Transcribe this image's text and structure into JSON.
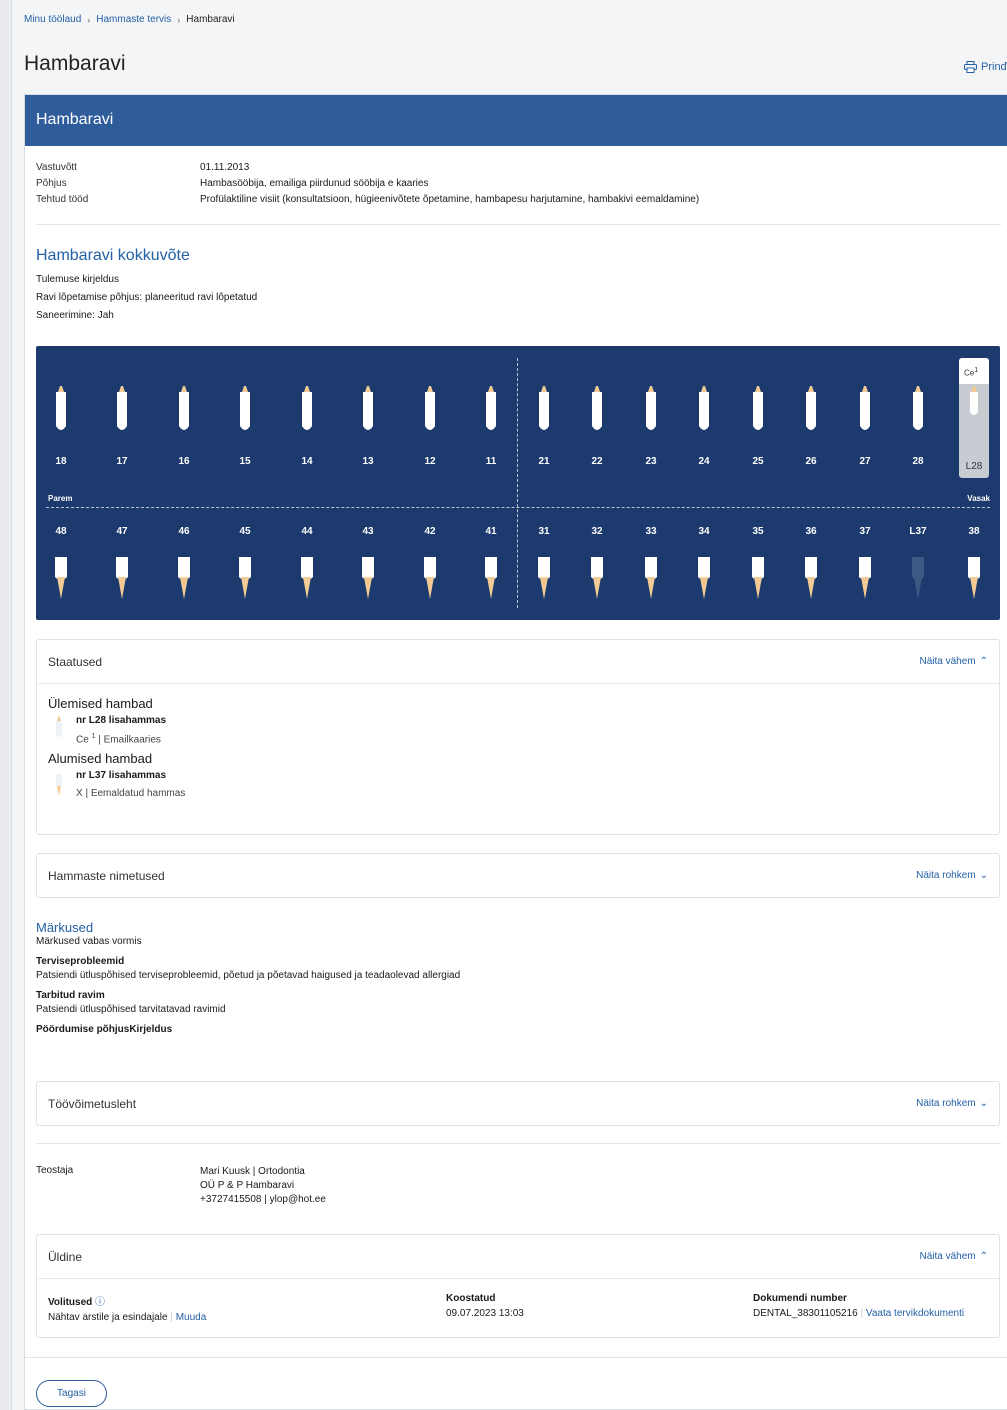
{
  "breadcrumb": [
    "Minu töölaud",
    "Hammaste tervis",
    "Hambaravi"
  ],
  "page_title": "Hambaravi",
  "print_label": "Prinď",
  "card_title": "Hambaravi",
  "info": [
    {
      "label": "Vastuvõtt",
      "value": "01.11.2013"
    },
    {
      "label": "Põhjus",
      "value": "Hambasööbija, emailiga piirdunud sööbija e kaaries"
    },
    {
      "label": "Tehtud tööd",
      "value": "Profülaktiline visiit (konsultatsioon, hügieenivõtete õpetamine, hambapesu harjutamine, hambakivi eemaldamine)"
    }
  ],
  "summary": {
    "title": "Hambaravi kokkuvõte",
    "lines": [
      "Tulemuse kirjeldus",
      "Ravi lõpetamise põhjus: planeeritud ravi lõpetatud",
      "Saneerimine: Jah"
    ]
  },
  "chart": {
    "upper": [
      "18",
      "17",
      "16",
      "15",
      "14",
      "13",
      "12",
      "11",
      "21",
      "22",
      "23",
      "24",
      "25",
      "26",
      "27",
      "28"
    ],
    "lower": [
      "48",
      "47",
      "46",
      "45",
      "44",
      "43",
      "42",
      "41",
      "31",
      "32",
      "33",
      "34",
      "35",
      "36",
      "37",
      "L37",
      "38"
    ],
    "extra_label": "L28",
    "extra_code": "Ce",
    "extra_sup": "1",
    "right_label": "Parem",
    "left_label": "Vasak",
    "colors": {
      "bg": "#1c3a6e",
      "tooth": "#ffffff",
      "root": "#f3c994",
      "removed": "#3b5a83"
    }
  },
  "statuses": {
    "title": "Staatused",
    "toggle": "Näita vähem",
    "upper_title": "Ülemised hambad",
    "upper_item_title": "nr L28 lisahammas",
    "upper_code": "Ce",
    "upper_sup": "1",
    "upper_desc": "| Emailkaaries",
    "lower_title": "Alumised hambad",
    "lower_item_title": "nr L37 lisahammas",
    "lower_desc": "X | Eemaldatud hammas"
  },
  "tooth_names": {
    "title": "Hammaste nimetused",
    "toggle": "Näita rohkem"
  },
  "notes": {
    "title": "Märkused",
    "text": "Märkused vabas vormis",
    "health_title": "Terviseprobleemid",
    "health_text": "Patsiendi ütluspõhised terviseprobleemid, põetud ja põetavad haigused ja teadaolevad allergiad",
    "meds_title": "Tarbitud ravim",
    "meds_text": "Patsiendi ütluspõhised tarvitatavad ravimid",
    "reason_title": "Pöördumise põhjusKirjeldus"
  },
  "work_capacity": {
    "title": "Töövõimetusleht",
    "toggle": "Näita rohkem"
  },
  "executor": {
    "label": "Teostaja",
    "name": "Mari Kuusk | Ortodontia",
    "org": "OÜ P & P Hambaravi",
    "contact": "+3727415508 | ylop@hot.ee"
  },
  "general": {
    "title": "Üldine",
    "toggle": "Näita vähem",
    "perm_title": "Volitused",
    "perm_text": "Nähtav arstile ja esindajale",
    "perm_link": "Muuda",
    "compiled_title": "Koostatud",
    "compiled_value": "09.07.2023 13:03",
    "doc_title": "Dokumendi number",
    "doc_value": "DENTAL_38301105216",
    "doc_link": "Vaata tervikdokumenti"
  },
  "back_label": "Tagasi"
}
